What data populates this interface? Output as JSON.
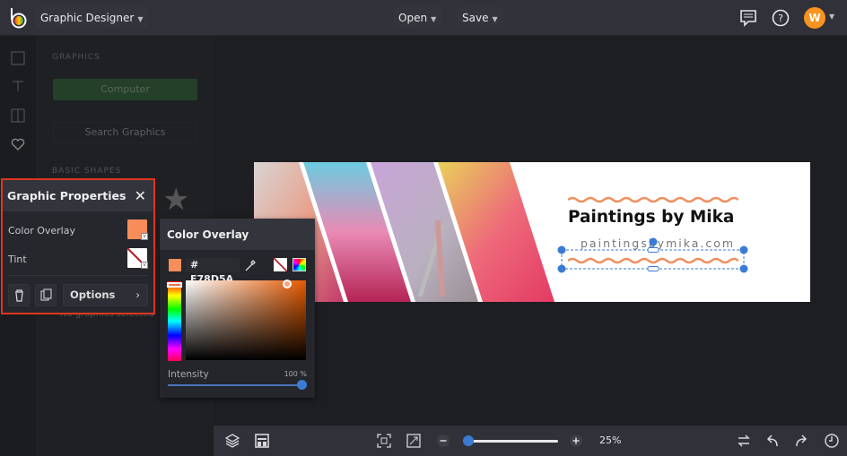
{
  "topbar": {
    "app_menu": "Graphic Designer",
    "open": "Open",
    "save": "Save",
    "avatar_initial": "W"
  },
  "sidebar": {
    "section_graphics": "GRAPHICS",
    "computer_button": "Computer",
    "search_button": "Search Graphics",
    "section_basic_shapes": "BASIC SHAPES",
    "empty_text": "No graphics selected"
  },
  "graphic_properties": {
    "title": "Graphic Properties",
    "color_overlay_label": "Color Overlay",
    "tint_label": "Tint",
    "options_label": "Options",
    "overlay_color": "#F78D5A"
  },
  "color_overlay": {
    "title": "Color Overlay",
    "hex_value": "# F78D5A",
    "intensity_label": "Intensity",
    "intensity_value": "100 %",
    "intensity_percent": 100
  },
  "canvas": {
    "headline": "Paintings by Mika",
    "url": "paintingsbymika.com",
    "wave_color": "#F0905E"
  },
  "bottombar": {
    "zoom_value": "25%",
    "zoom_percent": 25
  },
  "colors": {
    "accent": "#3a7bd5",
    "highlight_border": "#e0361f",
    "avatar": "#f7931e"
  }
}
